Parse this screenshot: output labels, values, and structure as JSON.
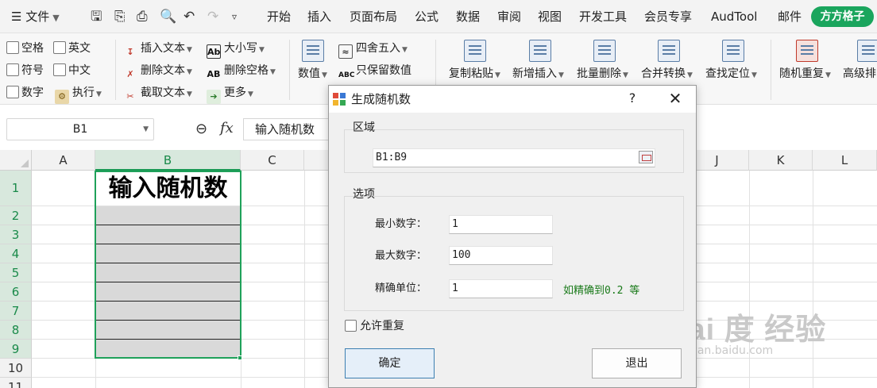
{
  "menubar": {
    "file_label": "文件",
    "tabs": [
      "开始",
      "插入",
      "页面布局",
      "公式",
      "数据",
      "审阅",
      "视图",
      "开发工具",
      "会员专享",
      "AudTool",
      "邮件"
    ],
    "brand_label": "方方格子",
    "brand_color": "#1aa55d"
  },
  "ribbon": {
    "checks": [
      "空格",
      "英文",
      "符号",
      "中文",
      "数字"
    ],
    "execute_label": "执行",
    "text_ops": [
      "插入文本",
      "删除文本",
      "截取文本"
    ],
    "case_label": "大小写",
    "remove_space_label": "删除空格",
    "more_label": "更多",
    "value_label": "数值",
    "round_label": "四舍五入",
    "keep_value_label": "只保留数值",
    "big_buttons": [
      "复制粘贴",
      "新增插入",
      "批量删除",
      "合并转换",
      "查找定位",
      "随机重复",
      "高级排"
    ]
  },
  "formula_bar": {
    "name_box": "B1",
    "formula_value": "输入随机数"
  },
  "grid": {
    "columns": [
      "A",
      "B",
      "C",
      "J",
      "K",
      "L"
    ],
    "rows": [
      "1",
      "2",
      "3",
      "4",
      "5",
      "6",
      "7",
      "8",
      "9",
      "10",
      "11"
    ],
    "cell_b1": "输入随机数",
    "selection_color": "#1fa15a"
  },
  "dialog": {
    "title": "生成随机数",
    "help": "?",
    "close": "✕",
    "range_group": "区域",
    "range_value": "B1:B9",
    "options_group": "选项",
    "min_label": "最小数字：",
    "min_value": "1",
    "max_label": "最大数字：",
    "max_value": "100",
    "precision_label": "精确单位：",
    "precision_value": "1",
    "precision_hint": "如精确到0.2 等",
    "allow_dup_label": "允许重复",
    "ok_label": "确定",
    "exit_label": "退出"
  },
  "watermark": {
    "logo": "Bai 度 经验",
    "url": "jingyan.baidu.com"
  }
}
